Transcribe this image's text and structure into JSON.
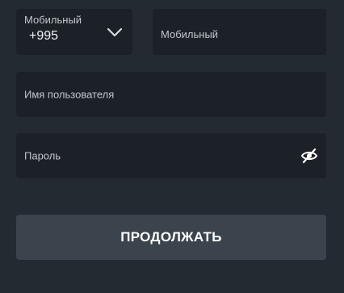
{
  "form": {
    "country_code": {
      "label": "Мобильный",
      "value": "+995",
      "icon": "chevron-down-icon"
    },
    "phone": {
      "placeholder": "Мобильный"
    },
    "username": {
      "placeholder": "Имя пользователя"
    },
    "password": {
      "placeholder": "Пароль",
      "icon": "eye-off-icon"
    },
    "submit_label": "ПРОДОЛЖАТЬ"
  },
  "colors": {
    "background": "#242a32",
    "field_bg": "#1c2127",
    "button_bg": "#3b434d",
    "text": "#ffffff",
    "muted_text": "#c2c6cc"
  }
}
